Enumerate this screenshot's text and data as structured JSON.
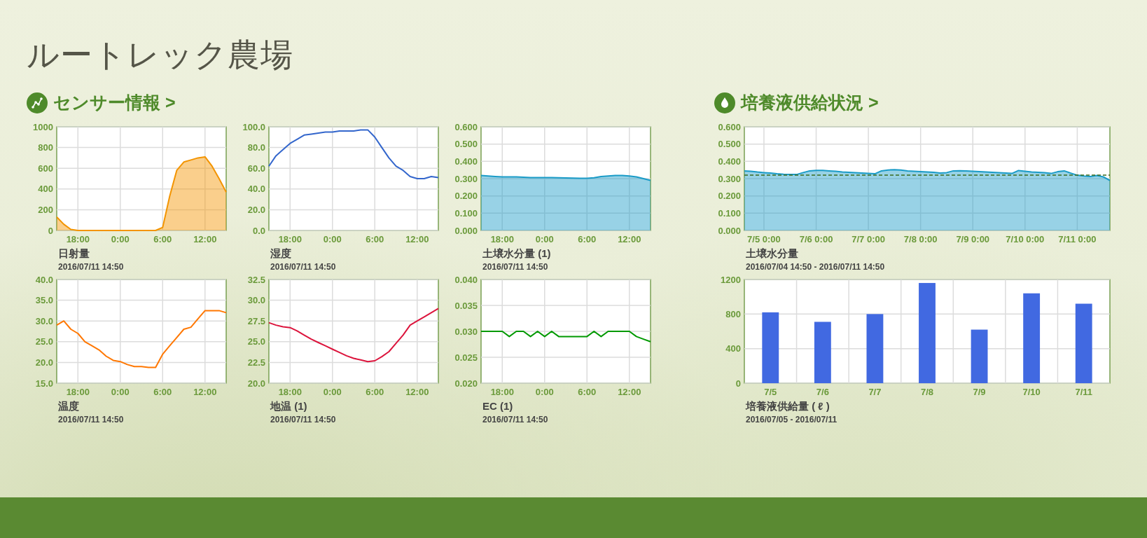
{
  "farm_title": "ルートレック農場",
  "sensors": {
    "heading": "センサー情報 >",
    "charts": [
      {
        "title": "日射量",
        "date": "2016/07/11 14:50",
        "chart_data": {
          "type": "area",
          "grid": true,
          "ylim": [
            0,
            1000
          ],
          "yticks": [
            0,
            200,
            400,
            600,
            800,
            1000
          ],
          "categories": [
            null,
            null,
            null,
            "18:00",
            null,
            null,
            null,
            null,
            null,
            "0:00",
            null,
            null,
            null,
            null,
            null,
            "6:00",
            null,
            null,
            null,
            null,
            null,
            "12:00",
            null,
            null,
            null
          ],
          "series": [
            {
              "color": "#f39400",
              "values": [
                130,
                60,
                10,
                0,
                0,
                0,
                0,
                0,
                0,
                0,
                0,
                0,
                0,
                0,
                0,
                30,
                330,
                580,
                660,
                680,
                700,
                710,
                620,
                500,
                370
              ]
            }
          ]
        }
      },
      {
        "title": "湿度",
        "date": "2016/07/11 14:50",
        "chart_data": {
          "type": "line",
          "grid": true,
          "ylim": [
            0,
            100
          ],
          "yticks": [
            {
              "value": 0,
              "label": "0.0"
            },
            {
              "value": 20,
              "label": "20.0"
            },
            {
              "value": 40,
              "label": "40.0"
            },
            {
              "value": 60,
              "label": "60.0"
            },
            {
              "value": 80,
              "label": "80.0"
            },
            {
              "value": 100,
              "label": "100.0"
            }
          ],
          "categories": [
            null,
            null,
            null,
            "18:00",
            null,
            null,
            null,
            null,
            null,
            "0:00",
            null,
            null,
            null,
            null,
            null,
            "6:00",
            null,
            null,
            null,
            null,
            null,
            "12:00",
            null,
            null,
            null
          ],
          "series": [
            {
              "color": "#3366cc",
              "values": [
                62,
                72,
                78,
                84,
                88,
                92,
                93,
                94,
                95,
                95,
                96,
                96,
                96,
                97,
                97,
                90,
                80,
                70,
                62,
                58,
                52,
                50,
                50,
                52,
                51
              ]
            }
          ]
        }
      },
      {
        "title": "土壌水分量 (1)",
        "date": "2016/07/11 14:50",
        "chart_data": {
          "grid": true,
          "type": "area",
          "ylim": [
            0,
            0.6
          ],
          "yticks": [
            {
              "value": 0,
              "label": "0.000"
            },
            {
              "value": 0.1,
              "label": "0.100"
            },
            {
              "value": 0.2,
              "label": "0.200"
            },
            {
              "value": 0.3,
              "label": "0.300"
            },
            {
              "value": 0.4,
              "label": "0.400"
            },
            {
              "value": 0.5,
              "label": "0.500"
            },
            {
              "value": 0.6,
              "label": "0.600"
            }
          ],
          "categories": [
            null,
            null,
            null,
            "18:00",
            null,
            null,
            null,
            null,
            null,
            "0:00",
            null,
            null,
            null,
            null,
            null,
            "6:00",
            null,
            null,
            null,
            null,
            null,
            "12:00",
            null,
            null,
            null
          ],
          "series": [
            {
              "color": "#1a9bc7",
              "values": [
                0.318,
                0.315,
                0.312,
                0.31,
                0.31,
                0.31,
                0.308,
                0.306,
                0.306,
                0.306,
                0.306,
                0.305,
                0.304,
                0.303,
                0.302,
                0.302,
                0.305,
                0.312,
                0.315,
                0.318,
                0.318,
                0.315,
                0.31,
                0.3,
                0.29
              ]
            }
          ]
        }
      },
      {
        "title": "温度",
        "date": "2016/07/11 14:50",
        "chart_data": {
          "type": "line",
          "grid": true,
          "ylim": [
            15,
            40
          ],
          "yticks": [
            {
              "value": 15,
              "label": "15.0"
            },
            {
              "value": 20,
              "label": "20.0"
            },
            {
              "value": 25,
              "label": "25.0"
            },
            {
              "value": 30,
              "label": "30.0"
            },
            {
              "value": 35,
              "label": "35.0"
            },
            {
              "value": 40,
              "label": "40.0"
            }
          ],
          "categories": [
            null,
            null,
            null,
            "18:00",
            null,
            null,
            null,
            null,
            null,
            "0:00",
            null,
            null,
            null,
            null,
            null,
            "6:00",
            null,
            null,
            null,
            null,
            null,
            "12:00",
            null,
            null,
            null
          ],
          "series": [
            {
              "color": "#ff7700",
              "values": [
                29,
                30,
                28,
                27,
                25,
                24,
                23,
                21.5,
                20.5,
                20.2,
                19.5,
                19,
                19,
                18.8,
                18.8,
                22,
                24,
                26,
                28,
                28.5,
                30.5,
                32.5,
                32.5,
                32.5,
                32
              ]
            }
          ]
        }
      },
      {
        "title": "地温 (1)",
        "date": "2016/07/11 14:50",
        "chart_data": {
          "type": "line",
          "grid": true,
          "ylim": [
            20,
            32.5
          ],
          "yticks": [
            {
              "value": 20,
              "label": "20.0"
            },
            {
              "value": 22.5,
              "label": "22.5"
            },
            {
              "value": 25,
              "label": "25.0"
            },
            {
              "value": 27.5,
              "label": "27.5"
            },
            {
              "value": 30,
              "label": "30.0"
            },
            {
              "value": 32.5,
              "label": "32.5"
            }
          ],
          "categories": [
            null,
            null,
            null,
            "18:00",
            null,
            null,
            null,
            null,
            null,
            "0:00",
            null,
            null,
            null,
            null,
            null,
            "6:00",
            null,
            null,
            null,
            null,
            null,
            "12:00",
            null,
            null,
            null
          ],
          "series": [
            {
              "color": "#dc143c",
              "values": [
                27.3,
                27.0,
                26.8,
                26.7,
                26.3,
                25.8,
                25.3,
                24.9,
                24.5,
                24.1,
                23.7,
                23.3,
                23.0,
                22.8,
                22.6,
                22.7,
                23.2,
                23.8,
                24.8,
                25.8,
                27.0,
                27.5,
                28.0,
                28.5,
                29.0
              ]
            }
          ]
        }
      },
      {
        "title": "EC (1)",
        "date": "2016/07/11 14:50",
        "chart_data": {
          "type": "line",
          "grid": true,
          "ylim": [
            0.02,
            0.04
          ],
          "yticks": [
            {
              "value": 0.02,
              "label": "0.020"
            },
            {
              "value": 0.025,
              "label": "0.025"
            },
            {
              "value": 0.03,
              "label": "0.030"
            },
            {
              "value": 0.035,
              "label": "0.035"
            },
            {
              "value": 0.04,
              "label": "0.040"
            }
          ],
          "categories": [
            null,
            null,
            null,
            "18:00",
            null,
            null,
            null,
            null,
            null,
            "0:00",
            null,
            null,
            null,
            null,
            null,
            "6:00",
            null,
            null,
            null,
            null,
            null,
            "12:00",
            null,
            null,
            null
          ],
          "series": [
            {
              "color": "#009900",
              "values": [
                0.03,
                0.03,
                0.03,
                0.03,
                0.029,
                0.03,
                0.03,
                0.029,
                0.03,
                0.029,
                0.03,
                0.029,
                0.029,
                0.029,
                0.029,
                0.029,
                0.03,
                0.029,
                0.03,
                0.03,
                0.03,
                0.03,
                0.029,
                0.0285,
                0.028
              ]
            }
          ]
        }
      }
    ]
  },
  "nutrient": {
    "heading": "培養液供給状況 >",
    "charts": [
      {
        "title": "土壌水分量",
        "date": "2016/07/04 14:50 - 2016/07/11 14:50",
        "chart_data": {
          "grid": true,
          "type": "area",
          "ylim": [
            0,
            0.6
          ],
          "yticks": [
            {
              "value": 0,
              "label": "0.000"
            },
            {
              "value": 0.1,
              "label": "0.100"
            },
            {
              "value": 0.2,
              "label": "0.200"
            },
            {
              "value": 0.3,
              "label": "0.300"
            },
            {
              "value": 0.4,
              "label": "0.400"
            },
            {
              "value": 0.5,
              "label": "0.500"
            },
            {
              "value": 0.6,
              "label": "0.600"
            }
          ],
          "categories": [
            null,
            null,
            null,
            "7/5 0:00",
            null,
            null,
            null,
            null,
            null,
            null,
            null,
            "7/6 0:00",
            null,
            null,
            null,
            null,
            null,
            null,
            null,
            "7/7 0:00",
            null,
            null,
            null,
            null,
            null,
            null,
            null,
            "7/8 0:00",
            null,
            null,
            null,
            null,
            null,
            null,
            null,
            "7/9 0:00",
            null,
            null,
            null,
            null,
            null,
            null,
            null,
            "7/10 0:00",
            null,
            null,
            null,
            null,
            null,
            null,
            null,
            "7/11 0:00",
            null,
            null,
            null,
            null,
            null
          ],
          "series": [
            {
              "color": "#1a9bc7",
              "values": [
                0.345,
                0.342,
                0.338,
                0.335,
                0.332,
                0.328,
                0.325,
                0.324,
                0.324,
                0.335,
                0.345,
                0.348,
                0.348,
                0.345,
                0.342,
                0.338,
                0.336,
                0.335,
                0.333,
                0.33,
                0.328,
                0.345,
                0.35,
                0.352,
                0.35,
                0.345,
                0.342,
                0.34,
                0.338,
                0.336,
                0.333,
                0.335,
                0.345,
                0.346,
                0.345,
                0.343,
                0.34,
                0.338,
                0.336,
                0.335,
                0.333,
                0.33,
                0.347,
                0.342,
                0.338,
                0.336,
                0.334,
                0.33,
                0.34,
                0.345,
                0.332,
                0.32,
                0.315,
                0.312,
                0.318,
                0.31,
                0.29
              ]
            },
            {
              "type": "line",
              "line_style": "dashed",
              "color": "#3a6b1e",
              "values": [
                0.32,
                0.32,
                0.32,
                0.32,
                0.32,
                0.32,
                0.32,
                0.32,
                0.32,
                0.32,
                0.32,
                0.32,
                0.32,
                0.32,
                0.32,
                0.32,
                0.32,
                0.32,
                0.32,
                0.32,
                0.32,
                0.32,
                0.32,
                0.32,
                0.32,
                0.32,
                0.32,
                0.32,
                0.32,
                0.32,
                0.32,
                0.32,
                0.32,
                0.32,
                0.32,
                0.32,
                0.32,
                0.32,
                0.32,
                0.32,
                0.32,
                0.32,
                0.32,
                0.32,
                0.32,
                0.32,
                0.32,
                0.32,
                0.32,
                0.32,
                0.32,
                0.32,
                0.32,
                0.32,
                0.32,
                0.32,
                0.32
              ]
            }
          ]
        }
      },
      {
        "title": "培養液供給量 ( ℓ )",
        "date": "2016/07/05 - 2016/07/11",
        "chart_data": {
          "type": "bar",
          "grid": true,
          "ylim": [
            0,
            1200
          ],
          "yticks": [
            0,
            400,
            800,
            1200
          ],
          "categories": [
            "7/5",
            "7/6",
            "7/7",
            "7/8",
            "7/9",
            "7/10",
            "7/11"
          ],
          "series": [
            {
              "color": "#4169e1",
              "values": [
                820,
                710,
                800,
                1160,
                620,
                1040,
                920
              ]
            }
          ]
        }
      }
    ]
  }
}
